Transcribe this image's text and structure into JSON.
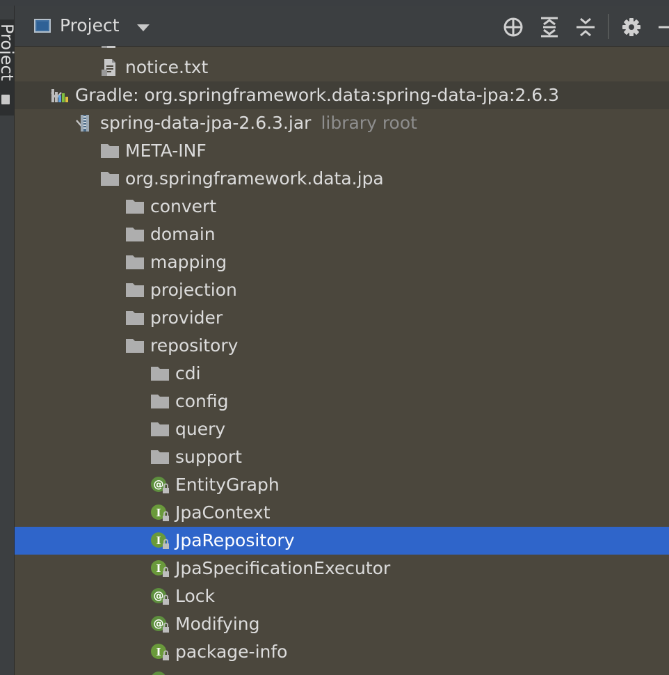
{
  "header": {
    "title": "Project",
    "tools": [
      "locate-icon",
      "expand-all-icon",
      "collapse-all-icon",
      "gear-icon",
      "hide-icon"
    ]
  },
  "sidebar": {
    "tab_label": "Project"
  },
  "tree": {
    "rows": [
      {
        "label": "notice.txt"
      },
      {
        "label": "Gradle: org.springframework.data:spring-data-jpa:2.6.3"
      },
      {
        "label": "spring-data-jpa-2.6.3.jar",
        "hint": "library root"
      },
      {
        "label": "META-INF"
      },
      {
        "label": "org.springframework.data.jpa"
      },
      {
        "label": "convert"
      },
      {
        "label": "domain"
      },
      {
        "label": "mapping"
      },
      {
        "label": "projection"
      },
      {
        "label": "provider"
      },
      {
        "label": "repository"
      },
      {
        "label": "cdi"
      },
      {
        "label": "config"
      },
      {
        "label": "query"
      },
      {
        "label": "support"
      },
      {
        "label": "EntityGraph"
      },
      {
        "label": "JpaContext"
      },
      {
        "label": "JpaRepository"
      },
      {
        "label": "JpaSpecificationExecutor"
      },
      {
        "label": "Lock"
      },
      {
        "label": "Modifying"
      },
      {
        "label": "package-info"
      }
    ]
  },
  "colors": {
    "selection": "#2f65ca",
    "background": "#4b473d",
    "header": "#3c3f41",
    "annotation_green": "#5e8f3e",
    "interface_green": "#6a9a3b"
  }
}
